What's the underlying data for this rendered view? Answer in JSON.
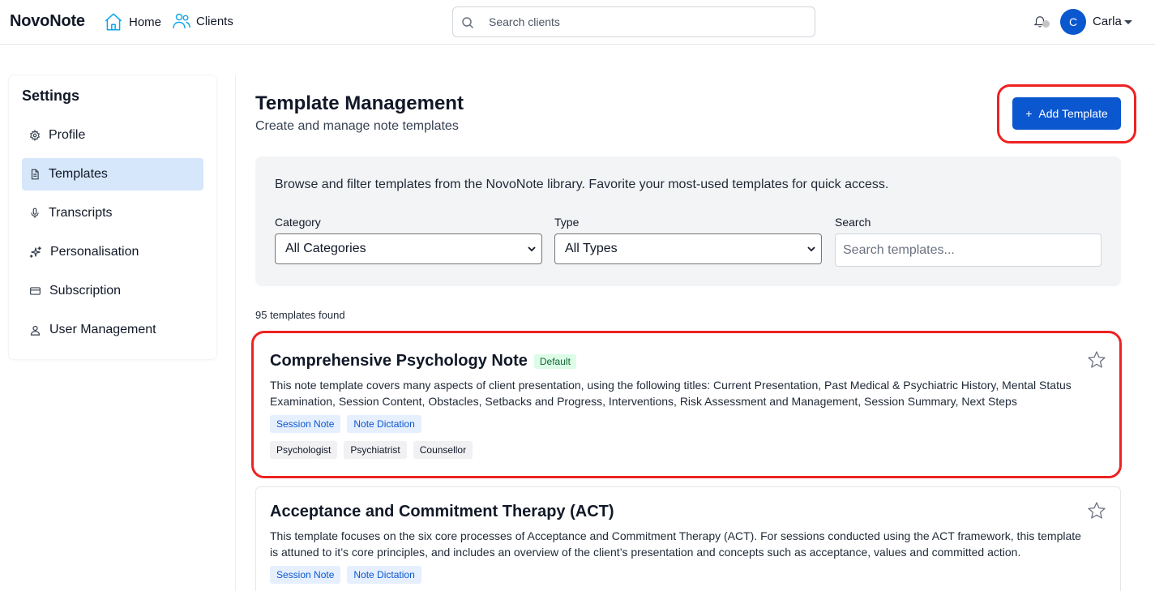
{
  "app": {
    "brand": "NovoNote",
    "nav": {
      "home": "Home",
      "clients": "Clients"
    },
    "search_placeholder": "Search clients",
    "user": {
      "initial": "C",
      "name": "Carla"
    }
  },
  "sidebar": {
    "title": "Settings",
    "items": [
      {
        "label": "Profile",
        "icon": "gear-icon",
        "active": false
      },
      {
        "label": "Templates",
        "icon": "document-icon",
        "active": true
      },
      {
        "label": "Transcripts",
        "icon": "microphone-icon",
        "active": false
      },
      {
        "label": "Personalisation",
        "icon": "sparkle-icon",
        "active": false
      },
      {
        "label": "Subscription",
        "icon": "credit-card-icon",
        "active": false
      },
      {
        "label": "User Management",
        "icon": "user-icon",
        "active": false
      }
    ]
  },
  "main": {
    "title": "Template Management",
    "subtitle": "Create and manage note templates",
    "add_button": {
      "icon": "+",
      "label": "Add Template"
    },
    "filters": {
      "intro": "Browse and filter templates from the NovoNote library. Favorite your most-used templates for quick access.",
      "category_label": "Category",
      "category_value": "All Categories",
      "type_label": "Type",
      "type_value": "All Types",
      "search_label": "Search",
      "search_placeholder": "Search templates..."
    },
    "count_text": "95 templates found",
    "templates": [
      {
        "title": "Comprehensive Psychology Note",
        "badge": "Default",
        "description": "This note template covers many aspects of client presentation, using the following titles: Current Presentation, Past Medical & Psychiatric History, Mental Status Examination, Session Content, Obstacles, Setbacks and Progress, Interventions, Risk Assessment and Management, Session Summary, Next Steps",
        "type_tags": [
          "Session Note",
          "Note Dictation"
        ],
        "role_tags": [
          "Psychologist",
          "Psychiatrist",
          "Counsellor"
        ]
      },
      {
        "title": "Acceptance and Commitment Therapy (ACT)",
        "description": "This template focuses on the six core processes of Acceptance and Commitment Therapy (ACT). For sessions conducted using the ACT framework, this template is attuned to it’s core principles, and includes an overview of the client’s presentation and concepts such as acceptance, values and committed action.",
        "type_tags": [
          "Session Note",
          "Note Dictation"
        ]
      }
    ]
  },
  "colors": {
    "accent": "#0b57d0",
    "highlight": "#ee2222",
    "active_nav": "#d6e6fb"
  }
}
